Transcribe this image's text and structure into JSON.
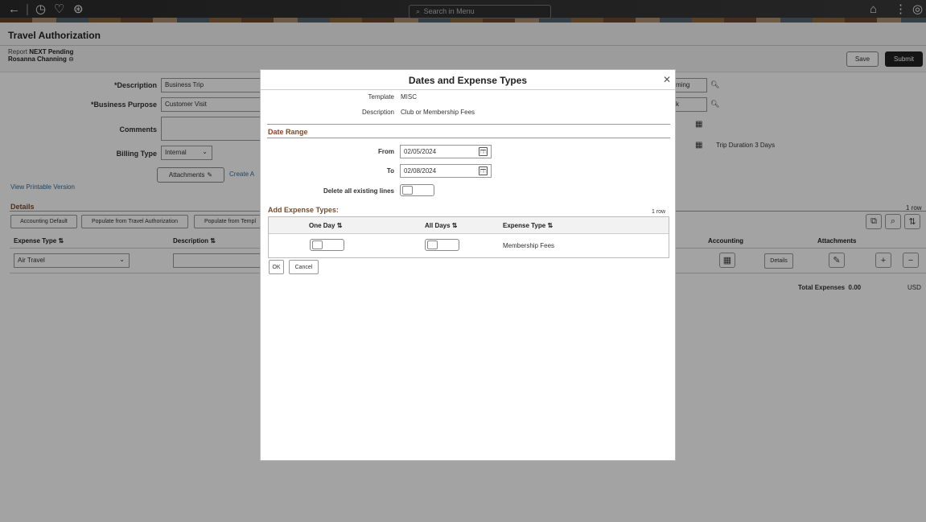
{
  "topbar": {
    "search_placeholder": "Search in Menu",
    "icons": [
      "back-arrow-icon",
      "history-icon",
      "favorites-icon",
      "accessibility-icon",
      "home-icon",
      "more-icon",
      "navbar-icon"
    ]
  },
  "page": {
    "title": "Travel Authorization",
    "report_label": "Report",
    "report_id": "NEXT",
    "status": "Pending",
    "owner": "Rosanna Channing",
    "save_label": "Save",
    "submit_label": "Submit"
  },
  "form": {
    "description_label": "*Description",
    "description_value": "Business Trip",
    "business_purpose_label": "*Business Purpose",
    "business_purpose_value": "Customer Visit",
    "comments_label": "Comments",
    "billing_type_label": "Billing Type",
    "billing_type_value": "Internal",
    "attachments_label": "Attachments",
    "create_link": "Create A",
    "view_printable_label": "View Printable Version",
    "right_field1_value": "ming",
    "right_field2_value": "k",
    "trip_duration_label": "Trip Duration",
    "trip_duration_value": "3 Days"
  },
  "details": {
    "title": "Details",
    "row_count": "1 row",
    "buttons": [
      "Accounting Default",
      "Populate from Travel Authorization",
      "Populate from Templ"
    ],
    "col_expense_type": "Expense Type",
    "col_description": "Description",
    "col_accounting": "Accounting",
    "col_attachments": "Attachments",
    "row_expense_type": "Air Travel",
    "details_btn": "Details",
    "total_label": "Total Expenses",
    "total_value": "0.00",
    "currency": "USD"
  },
  "modal": {
    "title": "Dates and Expense Types",
    "template_label": "Template",
    "template_value": "MISC",
    "description_label": "Description",
    "description_value": "Club or Membership Fees",
    "date_range_title": "Date Range",
    "from_label": "From",
    "from_value": "02/05/2024",
    "to_label": "To",
    "to_value": "02/08/2024",
    "delete_lines_label": "Delete all existing lines",
    "add_expense_title": "Add Expense Types:",
    "row_count": "1 row",
    "col_one_day": "One Day",
    "col_all_days": "All Days",
    "col_expense_type": "Expense Type",
    "row_expense_type": "Membership Fees",
    "ok_label": "OK",
    "cancel_label": "Cancel"
  }
}
